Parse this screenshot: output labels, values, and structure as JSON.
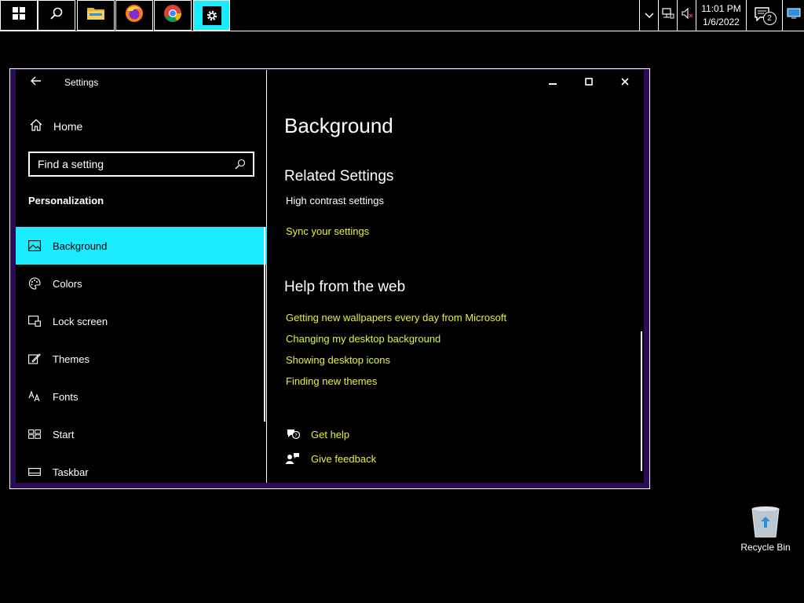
{
  "taskbar": {
    "start_icon": "windows-logo-icon",
    "search_icon": "search-icon",
    "apps": [
      {
        "name": "File Explorer",
        "icon": "folder-icon"
      },
      {
        "name": "Firefox",
        "icon": "firefox-icon"
      },
      {
        "name": "Chrome",
        "icon": "chrome-icon"
      },
      {
        "name": "Settings",
        "icon": "gear-icon"
      }
    ],
    "tray": {
      "time": "11:01 PM",
      "date": "1/6/2022",
      "notification_count": "2"
    }
  },
  "window": {
    "title": "Settings",
    "nav": {
      "home_label": "Home",
      "search_placeholder": "Find a setting",
      "section_heading": "Personalization",
      "items": [
        {
          "label": "Background",
          "icon": "image-icon",
          "selected": true
        },
        {
          "label": "Colors",
          "icon": "palette-icon",
          "selected": false
        },
        {
          "label": "Lock screen",
          "icon": "lock-screen-icon",
          "selected": false
        },
        {
          "label": "Themes",
          "icon": "brush-icon",
          "selected": false
        },
        {
          "label": "Fonts",
          "icon": "font-icon",
          "selected": false
        },
        {
          "label": "Start",
          "icon": "start-icon",
          "selected": false
        },
        {
          "label": "Taskbar",
          "icon": "taskbar-icon",
          "selected": false
        }
      ]
    },
    "content": {
      "title": "Background",
      "related_heading": "Related Settings",
      "high_contrast_label": "High contrast settings",
      "sync_link": "Sync your settings",
      "help_heading": "Help from the web",
      "help_links": [
        "Getting new wallpapers every day from Microsoft",
        "Changing my desktop background",
        "Showing desktop icons",
        "Finding new themes"
      ],
      "get_help_label": "Get help",
      "give_feedback_label": "Give feedback"
    }
  },
  "desktop": {
    "recycle_bin_label": "Recycle Bin"
  },
  "colors": {
    "accent": "#1aebff",
    "link": "#e5f23a",
    "window_frame": "#2a0b5a"
  }
}
